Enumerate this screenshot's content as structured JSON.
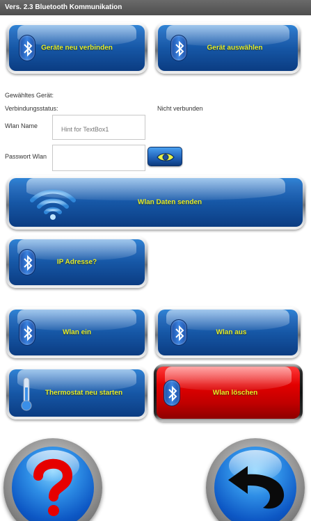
{
  "titlebar": {
    "title": "Vers. 2.3 Bluetooth Kommunikation"
  },
  "buttons": {
    "reconnect": "Geräte  neu verbinden",
    "select_device": "Gerät auswählen",
    "send_wifi": "Wlan Daten senden",
    "ip_address": "IP Adresse?",
    "wifi_on": "Wlan ein",
    "wifi_off": "Wlan aus",
    "restart_thermostat": "Thermostat neu starten",
    "delete_wifi": "Wlan löschen"
  },
  "form": {
    "selected_device_label": "Gewähltes Gerät:",
    "connection_status_label": "Verbindungsstatus:",
    "connection_status_value": "Nicht verbunden",
    "wifi_name_label": "Wlan Name",
    "wifi_name_placeholder": "Hint for TextBox1",
    "wifi_password_label": "Passwort Wlan"
  },
  "icons": {
    "bluetooth": "bluetooth-icon",
    "wifi": "wifi-icon",
    "thermometer": "thermometer-icon",
    "eye": "eye-icon",
    "help": "question-mark-icon",
    "back": "back-arrow-icon"
  },
  "colors": {
    "button_label": "#e7ee2a",
    "button_blue": "#1657a6",
    "delete_red": "#d10000"
  }
}
